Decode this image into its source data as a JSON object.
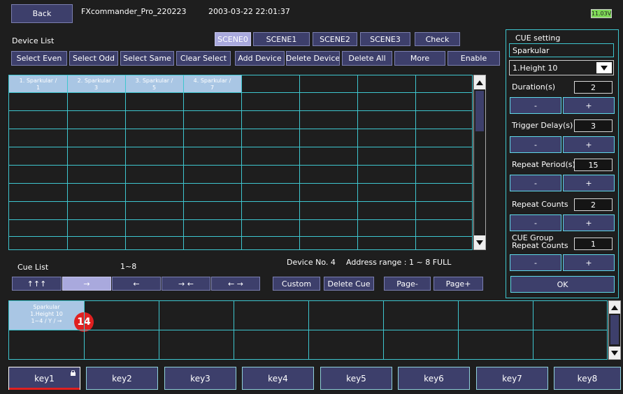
{
  "header": {
    "back": "Back",
    "app": "FXcommander_Pro_220223",
    "datetime": "2003-03-22 22:01:37",
    "battery": "11.03V"
  },
  "device": {
    "title": "Device List",
    "scenes": [
      "SCENE0",
      "SCENE1",
      "SCENE2",
      "SCENE3"
    ],
    "check": "Check",
    "toolbar": [
      "Select Even",
      "Select Odd",
      "Select Same",
      "Clear Select",
      "Add Device",
      "Delete Device",
      "Delete All",
      "More",
      "Enable"
    ],
    "cells": [
      [
        "1. Sparkular /",
        "1"
      ],
      [
        "2. Sparkular /",
        "3"
      ],
      [
        "3. Sparkular /",
        "5"
      ],
      [
        "4. Sparkular /",
        "7"
      ]
    ],
    "device_no": "Device No. 4",
    "address": "Address range : 1 ~ 8 FULL"
  },
  "cue": {
    "title": "Cue List",
    "range": "1~8",
    "buttons": [
      "↑↑↑",
      "→",
      "←",
      "→ ←",
      "← →"
    ],
    "custom": "Custom",
    "delete_cue": "Delete Cue",
    "page_minus": "Page-",
    "page_plus": "Page+",
    "cell_lines": [
      "Sparkular",
      "1.Height 10",
      "1~4 / Y / →"
    ],
    "badge": "14"
  },
  "setting": {
    "title": "CUE setting",
    "device": "Sparkular",
    "effect": "1.Height 10",
    "params": [
      {
        "label": "Duration(s)",
        "value": "2"
      },
      {
        "label": "Trigger Delay(s)",
        "value": "3"
      },
      {
        "label": "Repeat Period(s)",
        "value": "15"
      },
      {
        "label": "Repeat Counts",
        "value": "2"
      },
      {
        "label": "CUE Group",
        "label2": "Repeat Counts",
        "value": "1"
      }
    ],
    "minus": "-",
    "plus": "+",
    "ok": "OK"
  },
  "keys": [
    "key1",
    "key2",
    "key3",
    "key4",
    "key5",
    "key6",
    "key7",
    "key8"
  ],
  "colors": {
    "bg": "#1e1e1e",
    "button": "#3d3f6b",
    "selected": "#a9a9dd",
    "grid": "#3ec6cf",
    "badge": "#e02020",
    "battery": "#7ed957"
  }
}
